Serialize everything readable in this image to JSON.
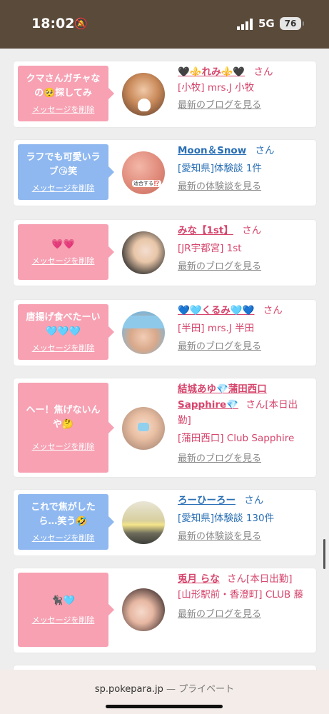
{
  "status": {
    "time": "18:02",
    "network": "5G",
    "battery": "76"
  },
  "url_bar": {
    "domain": "sp.pokepara.jp",
    "separator": " — ",
    "mode": "プライベート"
  },
  "delete_label": "メッセージを削除",
  "cards": [
    {
      "message": "クマさんガチャなの🥺探してみ",
      "bubble_color": "pink",
      "name": "🖤⚜️れみ⚜️🖤",
      "suffix": "さん",
      "sub": "[小牧] mrs.J 小牧",
      "link": "最新のブログを見る",
      "theme": "pink"
    },
    {
      "message": "ラフでも可愛いラブ😘笑",
      "bubble_color": "blue",
      "name": "Moon＆Snow",
      "suffix": "さん",
      "sub": "[愛知県]体験談 1件",
      "link": "最新の体験談を見る",
      "theme": "blue",
      "avatar_label": "适合する⁉️"
    },
    {
      "message": "💗💗",
      "bubble_color": "pink",
      "name": "みな【1st】",
      "suffix": "さん",
      "sub": "[JR宇都宮] 1st",
      "link": "最新のブログを見る",
      "theme": "pink"
    },
    {
      "message": "唐揚げ食べたーい🩵🩵🩵",
      "bubble_color": "pink",
      "name": "💙🩵くるみ🩵💙",
      "suffix": "さん",
      "sub": "[半田] mrs.J 半田",
      "link": "最新のブログを見る",
      "theme": "pink"
    },
    {
      "message": "ヘー！焦げないんや🤔",
      "bubble_color": "pink",
      "name": "結城あゆ💎蒲田西口Sapphire💎",
      "suffix": "さん[本日出勤]",
      "sub": "[蒲田西口] Club Sapphire",
      "link": "最新のブログを見る",
      "theme": "pink"
    },
    {
      "message": "これで焦がしたら…笑う🤣",
      "bubble_color": "blue",
      "name": "ろーひーろー",
      "suffix": "さん",
      "sub": "[愛知県]体験談 130件",
      "link": "最新の体験談を見る",
      "theme": "blue"
    },
    {
      "message": "🐈‍⬛🩵",
      "bubble_color": "pink",
      "name": "兎月 らな",
      "suffix": "さん[本日出勤]",
      "sub": "[山形駅前・香澄町] CLUB 藤",
      "link": "最新のブログを見る",
      "theme": "pink"
    }
  ]
}
